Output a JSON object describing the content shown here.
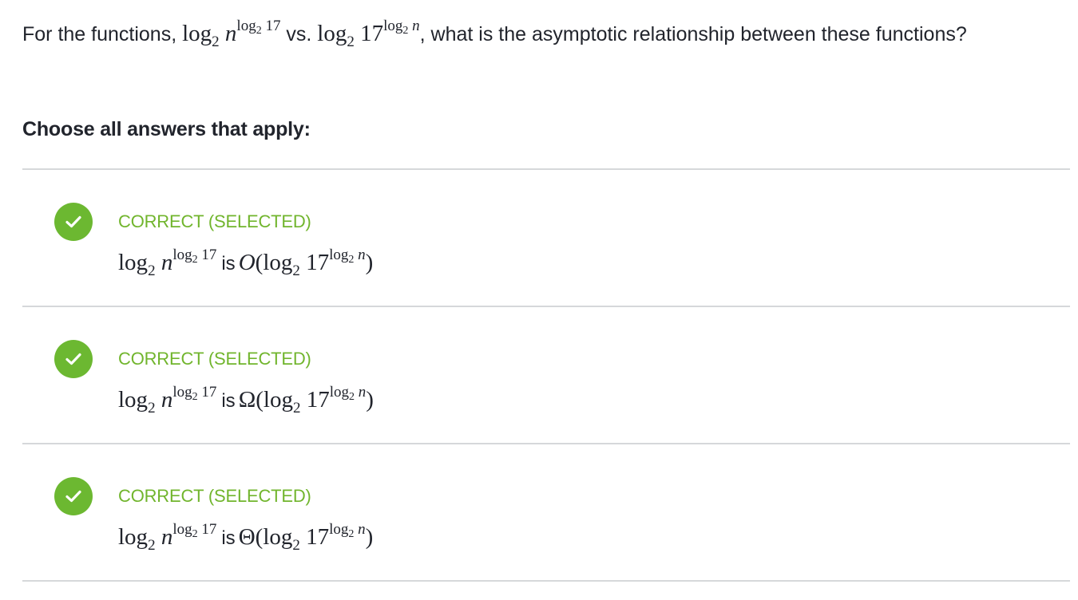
{
  "question": {
    "prefix": "For the functions, ",
    "f1": {
      "base": "log",
      "sub": "2",
      "var": "n",
      "sup_log": "log",
      "sup_sub": "2",
      "sup_arg": " 17"
    },
    "vs": " vs. ",
    "f2": {
      "base": "log",
      "sub": "2",
      "num": "17",
      "sup_log": "log",
      "sup_sub": "2",
      "sup_arg": " n"
    },
    "suffix": ", what is the asymptotic relationship between these functions?"
  },
  "prompt": "Choose all answers that apply:",
  "choices": [
    {
      "status": "CORRECT (SELECTED)",
      "selected": true,
      "relation": "O"
    },
    {
      "status": "CORRECT (SELECTED)",
      "selected": true,
      "relation": "Ω"
    },
    {
      "status": "CORRECT (SELECTED)",
      "selected": true,
      "relation": "Θ"
    }
  ],
  "answer_text": {
    "is": "is",
    "open": "(",
    "close": ")"
  },
  "colors": {
    "correct_green": "#6cb831",
    "status_text": "#71b52d",
    "divider": "#d6d8da",
    "text": "#21242c"
  },
  "icons": {
    "check": "checkmark-icon"
  }
}
